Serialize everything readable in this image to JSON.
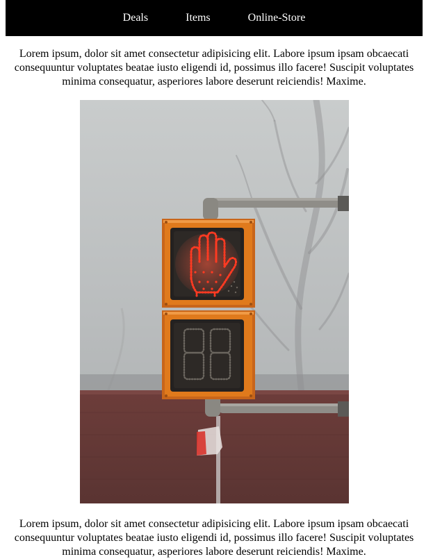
{
  "nav": {
    "items": [
      {
        "label": "Deals"
      },
      {
        "label": "Items"
      },
      {
        "label": "Online-Store"
      }
    ]
  },
  "content": {
    "paragraph_1": "Lorem ipsum, dolor sit amet consectetur adipisicing elit. Labore ipsum ipsam obcaecati consequuntur voluptates beatae iusto eligendi id, possimus illo facere! Suscipit voluptates minima consequatur, asperiores labore deserunt reiciendis! Maxime.",
    "paragraph_2": "Lorem ipsum, dolor sit amet consectetur adipisicing elit. Labore ipsum ipsam obcaecati consequuntur voluptates beatae iusto eligendi id, possimus illo facere! Suscipit voluptates minima consequatur, asperiores labore deserunt reiciendis! Maxime."
  },
  "colors": {
    "navbar_bg": "#000000",
    "nav_text": "#ffffff",
    "signal_housing": "#e07a1c",
    "signal_red": "#ff3a22"
  },
  "icons": {
    "photo_subject": "pedestrian-signal-hand"
  }
}
